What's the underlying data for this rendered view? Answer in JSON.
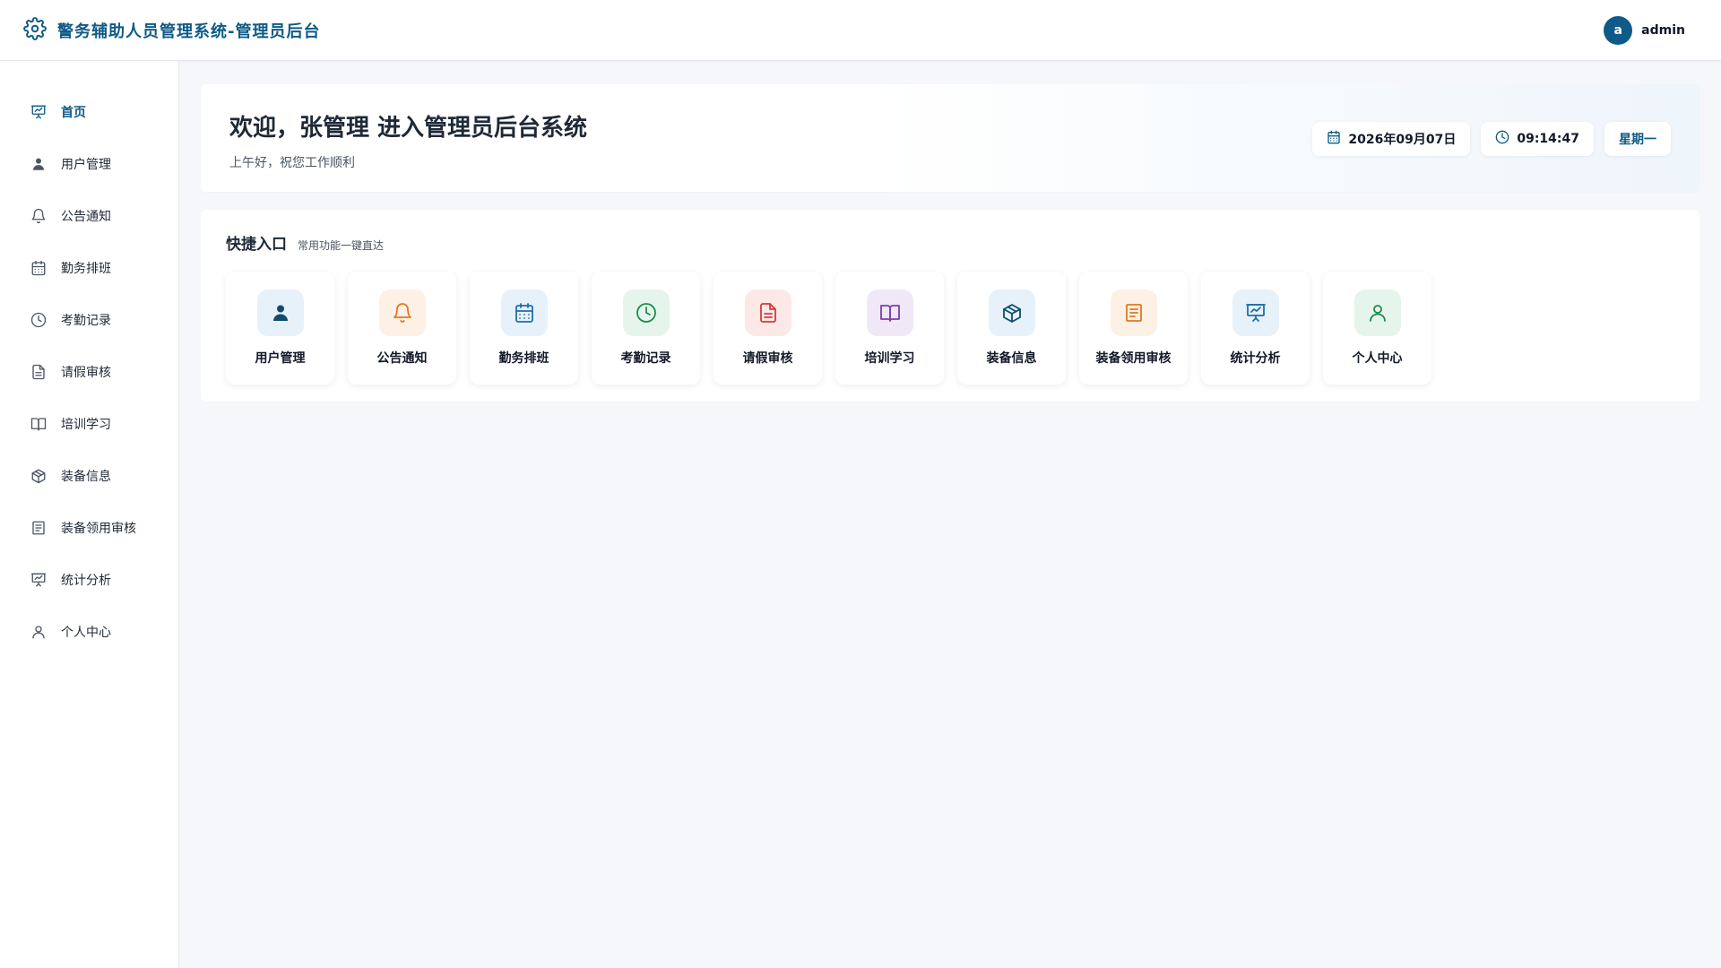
{
  "header": {
    "title": "警务辅助人员管理系统-管理员后台",
    "avatar_letter": "a",
    "username": "admin"
  },
  "sidebar": {
    "items": [
      {
        "label": "首页",
        "icon": "presentation-chart-icon",
        "active": true
      },
      {
        "label": "用户管理",
        "icon": "user-solid-icon"
      },
      {
        "label": "公告通知",
        "icon": "bell-icon"
      },
      {
        "label": "勤务排班",
        "icon": "calendar-icon"
      },
      {
        "label": "考勤记录",
        "icon": "clock-icon"
      },
      {
        "label": "请假审核",
        "icon": "document-icon"
      },
      {
        "label": "培训学习",
        "icon": "book-icon"
      },
      {
        "label": "装备信息",
        "icon": "package-icon"
      },
      {
        "label": "装备领用审核",
        "icon": "clipboard-icon"
      },
      {
        "label": "统计分析",
        "icon": "presentation-chart-icon"
      },
      {
        "label": "个人中心",
        "icon": "user-outline-icon"
      }
    ]
  },
  "welcome": {
    "title": "欢迎，张管理 进入管理员后台系统",
    "subtitle": "上午好，祝您工作顺利",
    "date": "2026年09月07日",
    "time": "09:14:47",
    "weekday": "星期一"
  },
  "quick": {
    "title": "快捷入口",
    "subtitle": "常用功能一键直达",
    "cards": [
      {
        "label": "用户管理",
        "icon": "user-solid-icon",
        "bg": "#e6f1fa",
        "color": "#0f4c6e"
      },
      {
        "label": "公告通知",
        "icon": "bell-icon",
        "bg": "#fdf0e4",
        "color": "#e07a1f"
      },
      {
        "label": "勤务排班",
        "icon": "calendar-icon",
        "bg": "#e6f1fa",
        "color": "#1d6fa5"
      },
      {
        "label": "考勤记录",
        "icon": "clock-icon",
        "bg": "#e5f5ec",
        "color": "#1f8a4c"
      },
      {
        "label": "请假审核",
        "icon": "document-icon",
        "bg": "#fde8e8",
        "color": "#d23b3b"
      },
      {
        "label": "培训学习",
        "icon": "book-icon",
        "bg": "#f1e8f7",
        "color": "#7d3fa6"
      },
      {
        "label": "装备信息",
        "icon": "package-icon",
        "bg": "#e6f1fa",
        "color": "#0f4c6e"
      },
      {
        "label": "装备领用审核",
        "icon": "clipboard-icon",
        "bg": "#fdf0e4",
        "color": "#e07a1f"
      },
      {
        "label": "统计分析",
        "icon": "presentation-chart-icon",
        "bg": "#e6f1fa",
        "color": "#1d6fa5"
      },
      {
        "label": "个人中心",
        "icon": "user-outline-icon",
        "bg": "#e5f5ec",
        "color": "#1f8a4c"
      }
    ]
  },
  "colors": {
    "primary": "#0f5a86",
    "nav_icon": "#4b5563"
  }
}
